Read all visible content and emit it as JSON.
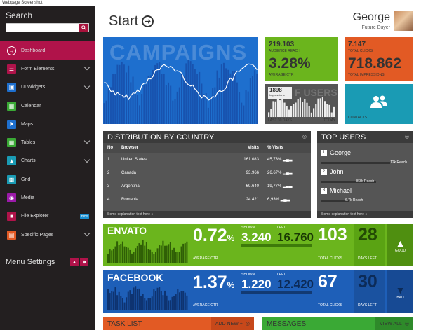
{
  "window": {
    "caption": "Webpage Screenshot"
  },
  "sidebar": {
    "title": "Search",
    "search_placeholder": "",
    "items": [
      {
        "label": "Dashboard",
        "icon": "arrow-right-icon",
        "color": "#b0134a",
        "active": true
      },
      {
        "label": "Form Elements",
        "icon": "form-icon",
        "color": "#b0134a"
      },
      {
        "label": "UI Widgets",
        "icon": "widgets-icon",
        "color": "#1e6fce"
      },
      {
        "label": "Calendar",
        "icon": "calendar-icon",
        "color": "#3aa935"
      },
      {
        "label": "Maps",
        "icon": "map-icon",
        "color": "#1e6fce"
      },
      {
        "label": "Tables",
        "icon": "table-icon",
        "color": "#3aa935"
      },
      {
        "label": "Charts",
        "icon": "chart-icon",
        "color": "#1a9bb4"
      },
      {
        "label": "Grid",
        "icon": "grid-icon",
        "color": "#1a9bb4"
      },
      {
        "label": "Media",
        "icon": "camera-icon",
        "color": "#9b1aa9"
      },
      {
        "label": "File Explorer",
        "icon": "folder-icon",
        "color": "#b0134a",
        "badge": "new"
      },
      {
        "label": "Specific Pages",
        "icon": "pages-icon",
        "color": "#e25a24"
      }
    ],
    "menu_settings": "Menu Settings"
  },
  "header": {
    "title": "Start",
    "user_name": "George",
    "user_role": "Future Buyer"
  },
  "tiles": {
    "campaigns": {
      "label": "CAMPAIGNS"
    },
    "audience": {
      "value": "219.103",
      "caption": "AUDIENCE REACH",
      "ctr": "3.28%",
      "ctr_caption": "AVERAGE CTR"
    },
    "clicks": {
      "value": "7.147",
      "caption": "TOTAL CLICKS",
      "impressions": "718.862",
      "imp_caption": "TOTAL IMPRESSIONS"
    },
    "users": {
      "impressions": "1898",
      "imp_caption": "Impressions",
      "bg_label": "F     USERS",
      "left": "LAST 30 DAYS",
      "right": "TODAY"
    },
    "contacts": {
      "caption": "CONTACTS"
    }
  },
  "distribution": {
    "title": "DISTRIBUTION BY COUNTRY",
    "headers": [
      "No",
      "Browser",
      "Visits",
      "% Visits"
    ],
    "rows": [
      {
        "no": "1",
        "name": "United States",
        "visits": "161.083",
        "pct": "45,73%"
      },
      {
        "no": "2",
        "name": "Canada",
        "visits": "93.966",
        "pct": "26,67%"
      },
      {
        "no": "3",
        "name": "Argentina",
        "visits": "69.640",
        "pct": "19,77%"
      },
      {
        "no": "4",
        "name": "Romania",
        "visits": "24.421",
        "pct": "6,93%"
      }
    ],
    "explanation": "Some explanation text here"
  },
  "top_users": {
    "title": "TOP USERS",
    "users": [
      {
        "no": "1",
        "name": "George",
        "reach": "12k Reach",
        "bar": 0.9
      },
      {
        "no": "2",
        "name": "John",
        "reach": "8.3k Reach",
        "bar": 0.72
      },
      {
        "no": "3",
        "name": "Michael",
        "reach": "6.7k Reach",
        "bar": 0.36
      }
    ],
    "explanation": "Some explanation text here"
  },
  "envato": {
    "name": "ENVATO",
    "ctr": "0.72",
    "ctr_unit": "%",
    "ctr_caption": "AVERAGE CTR",
    "shown_caption": "SHOWN",
    "shown": "3.240",
    "left_caption": "LEFT",
    "left": "16.760",
    "clicks": "103",
    "clicks_caption": "TOTAL CLICKS",
    "days": "28",
    "days_caption": "DAYS LEFT",
    "status": "GOOD",
    "color": "#6bb51d"
  },
  "facebook": {
    "name": "FACEBOOK",
    "ctr": "1.37",
    "ctr_unit": "%",
    "ctr_caption": "AVERAGE CTR",
    "shown_caption": "SHOWN",
    "shown": "1.220",
    "left_caption": "LEFT",
    "left": "12.420",
    "clicks": "67",
    "clicks_caption": "TOTAL CLICKS",
    "days": "30",
    "days_caption": "DAYS LEFT",
    "status": "BAD",
    "color": "#1e5fb8"
  },
  "task_list": {
    "title": "TASK LIST",
    "button": "ADD NEW +"
  },
  "messages": {
    "title": "MESSAGES",
    "button": "VIEW ALL"
  }
}
